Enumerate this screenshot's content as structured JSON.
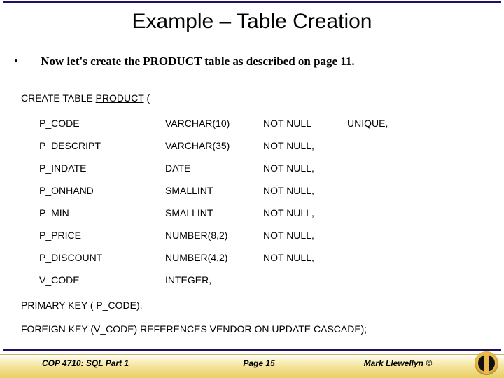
{
  "title": "Example – Table Creation",
  "bullet": "Now let's create the PRODUCT table as described on page 11.",
  "create": {
    "prefix": "CREATE TABLE ",
    "name": "PRODUCT",
    "suffix": " ("
  },
  "columns": [
    {
      "name": "P_CODE",
      "type": "VARCHAR(10)",
      "nullc": "NOT NULL",
      "extra": "UNIQUE,"
    },
    {
      "name": "P_DESCRIPT",
      "type": "VARCHAR(35)",
      "nullc": "NOT NULL,",
      "extra": ""
    },
    {
      "name": "P_INDATE",
      "type": "DATE",
      "nullc": "NOT NULL,",
      "extra": ""
    },
    {
      "name": "P_ONHAND",
      "type": "SMALLINT",
      "nullc": "NOT NULL,",
      "extra": ""
    },
    {
      "name": "P_MIN",
      "type": "SMALLINT",
      "nullc": "NOT NULL,",
      "extra": ""
    },
    {
      "name": "P_PRICE",
      "type": "NUMBER(8,2)",
      "nullc": "NOT NULL,",
      "extra": ""
    },
    {
      "name": "P_DISCOUNT",
      "type": "NUMBER(4,2)",
      "nullc": "NOT NULL,",
      "extra": ""
    },
    {
      "name": "V_CODE",
      "type": "INTEGER,",
      "nullc": "",
      "extra": ""
    }
  ],
  "tail": [
    "PRIMARY KEY ( P_CODE),",
    "FOREIGN KEY (V_CODE) REFERENCES VENDOR  ON UPDATE CASCADE);"
  ],
  "footer": {
    "left": "COP 4710: SQL Part 1",
    "mid": "Page 15",
    "right": "Mark Llewellyn ©"
  }
}
